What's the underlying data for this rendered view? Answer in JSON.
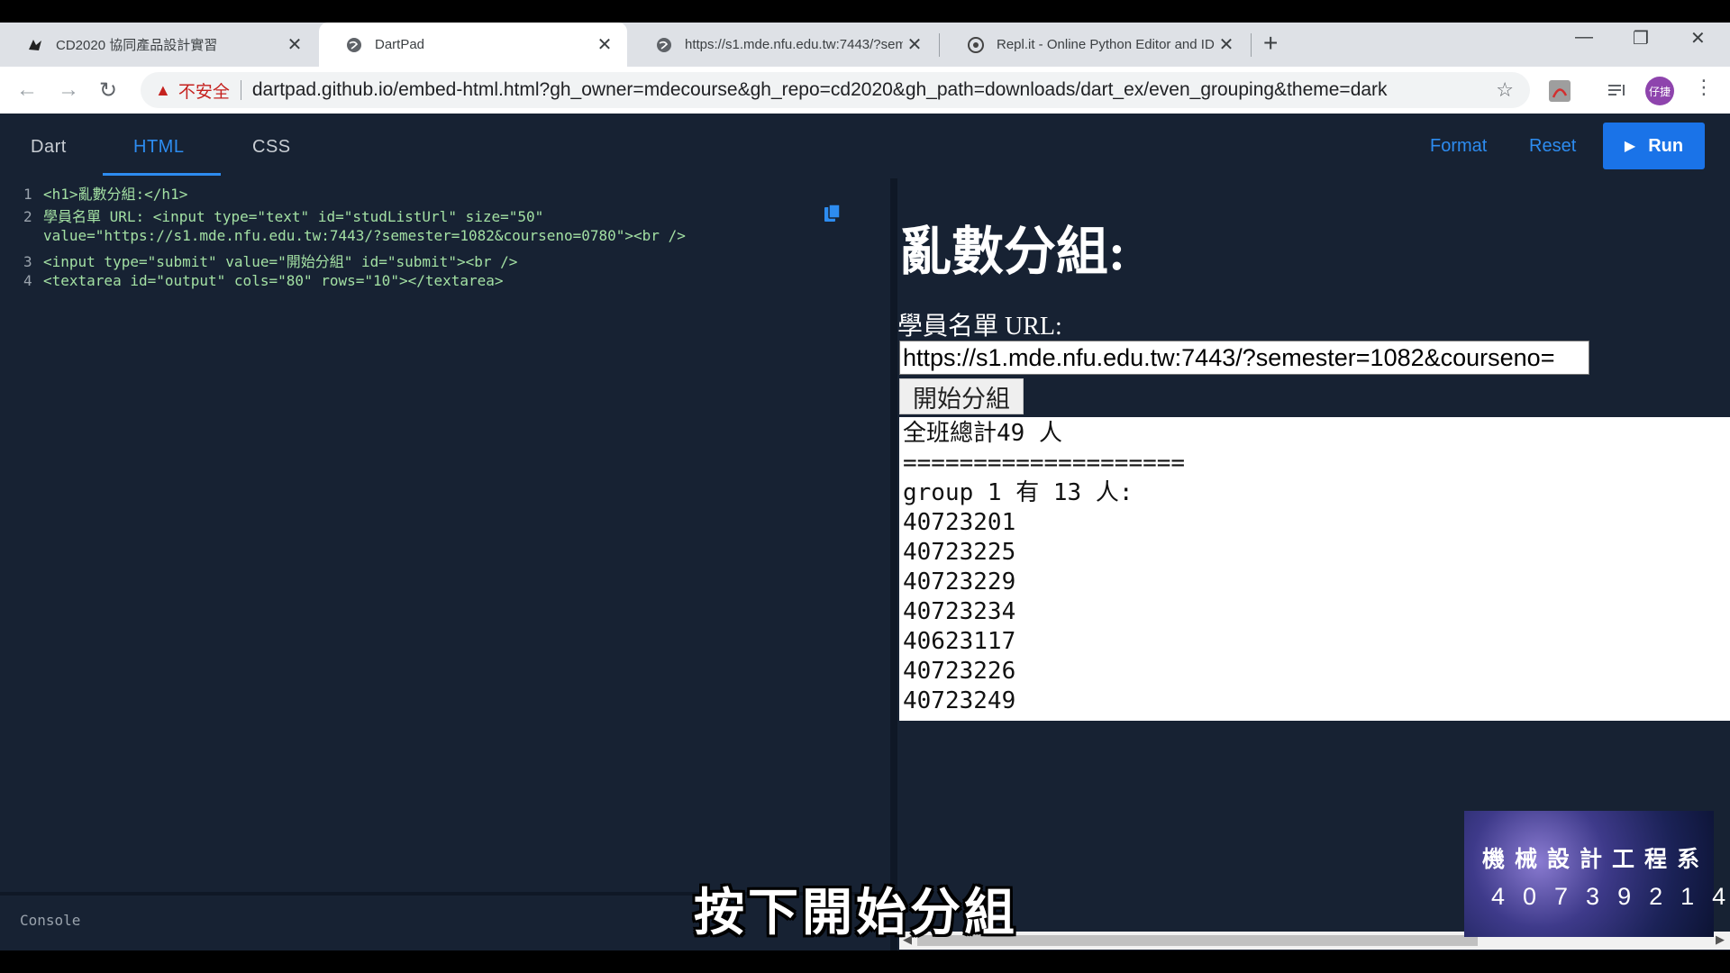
{
  "browser": {
    "tabs": [
      {
        "title": "CD2020 協同產品設計實習",
        "favicon": "bird-icon"
      },
      {
        "title": "DartPad",
        "favicon": "globe-icon",
        "active": true
      },
      {
        "title": "https://s1.mde.nfu.edu.tw:7443/?sem",
        "favicon": "globe-icon"
      },
      {
        "title": "Repl.it - Online Python Editor and IDE",
        "favicon": "replit-icon"
      }
    ],
    "address": {
      "security_label": "不安全",
      "url": "dartpad.github.io/embed-html.html?gh_owner=mdecourse&gh_repo=cd2020&gh_path=downloads/dart_ex/even_grouping&theme=dark"
    },
    "avatar_text": "仔捷"
  },
  "dartpad": {
    "tabs": {
      "dart": "Dart",
      "html": "HTML",
      "css": "CSS"
    },
    "actions": {
      "format": "Format",
      "reset": "Reset",
      "run": "Run"
    },
    "code_lines": [
      {
        "num": "1",
        "text": "<h1>亂數分組:</h1>"
      },
      {
        "num": "2",
        "text": "學員名單 URL: <input type=\"text\" id=\"studListUrl\" size=\"50\""
      },
      {
        "num": "",
        "text": "value=\"https://s1.mde.nfu.edu.tw:7443/?semester=1082&courseno=0780\"><br />"
      },
      {
        "num": "3",
        "text": "<input type=\"submit\" value=\"開始分組\" id=\"submit\"><br />"
      },
      {
        "num": "4",
        "text": "<textarea id=\"output\" cols=\"80\" rows=\"10\"></textarea>"
      }
    ],
    "console_label": "Console"
  },
  "output": {
    "heading": "亂數分組:",
    "label": "學員名單 URL:",
    "input_value": "https://s1.mde.nfu.edu.tw:7443/?semester=1082&courseno=",
    "button_label": "開始分組",
    "textarea_text": "全班總計49 人\n====================\ngroup 1 有 13 人:\n40723201\n40723225\n40723229\n40723234\n40623117\n40723226\n40723249"
  },
  "overlay": {
    "subtitle": "按下開始分組",
    "watermark_line1": "機械設計工程系",
    "watermark_line2": "40739214"
  },
  "colors": {
    "accent": "#2d8cf0",
    "run_button": "#1a73e8",
    "editor_bg": "#172233",
    "code_text": "#a3e0a3"
  }
}
